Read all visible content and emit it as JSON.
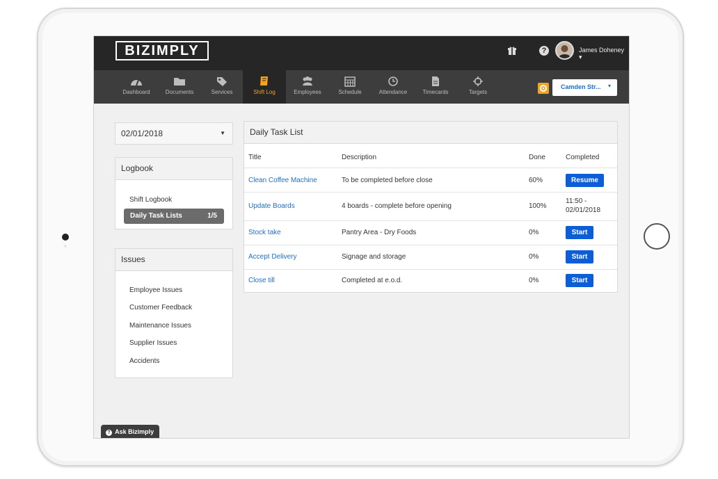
{
  "app": {
    "logo": "BIZIMPLY",
    "user_name": "James Doheney",
    "user_caret": "▾",
    "help_glyph": "?"
  },
  "nav": {
    "items": [
      {
        "label": "Dashboard",
        "icon": "dashboard-icon"
      },
      {
        "label": "Documents",
        "icon": "folder-icon"
      },
      {
        "label": "Services",
        "icon": "tags-icon"
      },
      {
        "label": "Shift Log",
        "icon": "book-icon",
        "active": true
      },
      {
        "label": "Employees",
        "icon": "users-icon"
      },
      {
        "label": "Schedule",
        "icon": "calendar-icon"
      },
      {
        "label": "Attendance",
        "icon": "clock-icon"
      },
      {
        "label": "Timecards",
        "icon": "file-icon"
      },
      {
        "label": "Targets",
        "icon": "crosshair-icon"
      }
    ],
    "location": "Camden Str...",
    "location_caret": "▾"
  },
  "sidebar": {
    "date": "02/01/2018",
    "date_caret": "▼",
    "logbook_title": "Logbook",
    "logbook_items": [
      {
        "label": "Shift Logbook"
      },
      {
        "label": "Daily Task Lists",
        "count": "1/5",
        "active": true
      }
    ],
    "issues_title": "Issues",
    "issues_items": [
      "Employee Issues",
      "Customer Feedback",
      "Maintenance Issues",
      "Supplier Issues",
      "Accidents"
    ]
  },
  "tasks": {
    "title": "Daily Task List",
    "columns": [
      "Title",
      "Description",
      "Done",
      "Completed"
    ],
    "rows": [
      {
        "title": "Clean Coffee Machine",
        "description": "To be completed before close",
        "done": "60%",
        "action": "Resume"
      },
      {
        "title": "Update Boards",
        "description": "4 boards - complete before opening",
        "done": "100%",
        "completed_time": "11:50 -",
        "completed_date": "02/01/2018"
      },
      {
        "title": "Stock take",
        "description": "Pantry Area - Dry Foods",
        "done": "0%",
        "action": "Start"
      },
      {
        "title": "Accept Delivery",
        "description": "Signage and storage",
        "done": "0%",
        "action": "Start"
      },
      {
        "title": "Close till",
        "description": "Completed at e.o.d.",
        "done": "0%",
        "action": "Start"
      }
    ]
  },
  "help": {
    "label": "Ask Bizimply",
    "glyph": "?"
  },
  "colors": {
    "accent": "#f7a21b",
    "link": "#1a6fd1",
    "button": "#0b5ed7",
    "topbar": "#262626",
    "navbar": "#3d3d3d"
  }
}
